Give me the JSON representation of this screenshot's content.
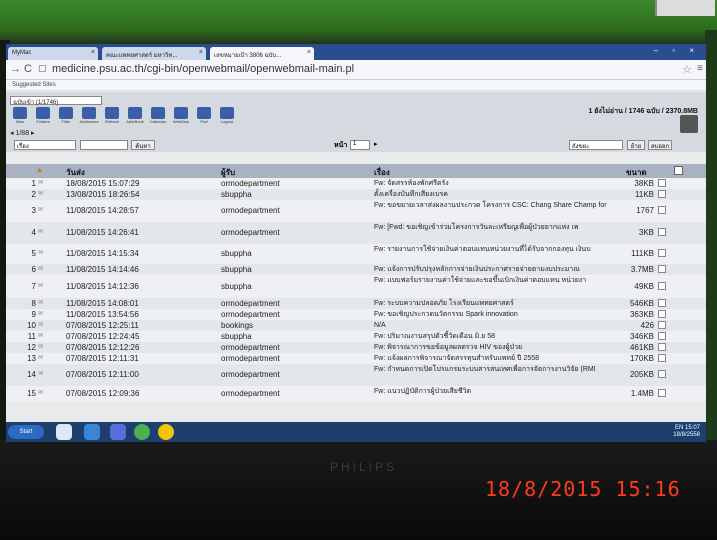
{
  "browser": {
    "tabs": [
      {
        "label": "MyMac"
      },
      {
        "label": "คณะแพทยศาสตร์ มหาวิท..."
      },
      {
        "label": "เลขหมายเป้า 3806 ฉบับ..."
      }
    ],
    "url": "medicine.psu.ac.th/cgi-bin/openwebmail/openwebmail-main.pl",
    "bookmarks_label": "Suggested Sites"
  },
  "webmail": {
    "folder": "ฉบับเข้า (1/1746)",
    "toolbar": [
      {
        "label": "New",
        "icon": "compose-icon"
      },
      {
        "label": "Folders",
        "icon": "folders-icon"
      },
      {
        "label": "Filter",
        "icon": "filter-icon"
      },
      {
        "label": "Addresses",
        "icon": "addressbook-icon"
      },
      {
        "label": "Refresh",
        "icon": "refresh-icon"
      },
      {
        "label": "AddrBook",
        "icon": "contacts-icon"
      },
      {
        "label": "Calendar",
        "icon": "calendar-icon"
      },
      {
        "label": "WebDisk",
        "icon": "webdisk-icon"
      },
      {
        "label": "Pref",
        "icon": "preferences-icon"
      },
      {
        "label": "Logout",
        "icon": "logout-icon"
      }
    ],
    "message_count": "1 ยังไม่อ่าน / 1746 ฉบับ / 2370.8MB",
    "trash_label": "ถังขยะ",
    "page_nav": "◂ 1/88 ▸",
    "search": {
      "field": "เรื่อง",
      "button": "ค้นหา"
    },
    "page": {
      "label": "หน้า",
      "value": "1"
    },
    "move": {
      "target": "ถังขยะ",
      "move_button": "ย้าย",
      "delete_button": "ลบออก"
    },
    "columns": {
      "date": "วันส่ง",
      "from": "ผู้รับ",
      "subject": "เรื่อง",
      "size": "ขนาด"
    },
    "messages": [
      {
        "num": "1",
        "date": "18/08/2015 15:07:29",
        "from": "ormodepartment",
        "subject": "Fw: จัดสรรห้องพักศรีตรัง",
        "size": "38KB"
      },
      {
        "num": "2",
        "date": "13/08/2015 18:26:54",
        "from": "sbuppha",
        "subject": "ตั้งเครื่องบันทึกเสียงเบรค",
        "size": "11KB"
      },
      {
        "num": "3",
        "date": "11/08/2015 14:28:57",
        "from": "ormodepartment",
        "subject": "Fw: ขอขยายเวลาส่งผลงานประกวด โครงการ CSC: Chang Share Champ for",
        "size": "1767"
      },
      {
        "num": "4",
        "date": "11/08/2015 14:26:41",
        "from": "ormodepartment",
        "subject": "Fw: [Fwd: ขอเชิญเข้าร่วมโครงการวันละเหรียญเพื่อผู้ป่วยยากแห่ง เพ",
        "size": "3KB"
      },
      {
        "num": "5",
        "date": "11/08/2015 14:15:34",
        "from": "sbuppha",
        "subject": "Fw: รายงานการใช้จ่ายเงินค่าตอบแทนหน่วยงานที่ได้รับจากกองทุน เงินบ",
        "size": "111KB"
      },
      {
        "num": "6",
        "date": "11/08/2015 14:14:46",
        "from": "sbuppha",
        "subject": "Fw: แจ้งการปรับปรุงหลักการจ่ายเงินประกาศรายจ่ายตามงบประมาณ",
        "size": "3.7MB"
      },
      {
        "num": "7",
        "date": "11/08/2015 14:12:36",
        "from": "sbuppha",
        "subject": "Fw: แบบฟอร์มรายงานค่าใช้จ่ายและขอขึ้นเบิกเงินค่าตอบแทน หน่วยงา",
        "size": "49KB"
      },
      {
        "num": "8",
        "date": "11/08/2015 14:08:01",
        "from": "ormodepartment",
        "subject": "Fw: ระบบความปลอดภัย โรงเรียนแพทยศาสตร์",
        "size": "546KB"
      },
      {
        "num": "9",
        "date": "11/08/2015 13:54:56",
        "from": "ormodepartment",
        "subject": "Fw: ขอเชิญประกวดนวัตกรรม Spark innovation",
        "size": "363KB"
      },
      {
        "num": "10",
        "date": "07/08/2015 12:25:11",
        "from": "bookings",
        "subject": "N/A",
        "size": "426"
      },
      {
        "num": "11",
        "date": "07/08/2015 12:24:45",
        "from": "sbuppha",
        "subject": "Fw: ปริมาณงานสรุปตัวชี้วัดเดือน มิ.ย 58",
        "size": "346KB"
      },
      {
        "num": "12",
        "date": "07/08/2015 12:12:26",
        "from": "ormodepartment",
        "subject": "Fw: พิจารณาการขอข้อมูลผลตรวจ HIV ของผู้ป่วย",
        "size": "461KB"
      },
      {
        "num": "13",
        "date": "07/08/2015 12:11:31",
        "from": "ormodepartment",
        "subject": "Fw: แจ้งผลการพิจารณาจัดสรรทุนสำหรับแพทย์ ปี 2558",
        "size": "170KB"
      },
      {
        "num": "14",
        "date": "07/08/2015 12:11:00",
        "from": "ormodepartment",
        "subject": "Fw: กำหนดการเปิดโปรแกรมระบบสารสนเทศเพื่อการจัดการงานวิจัย (RMI",
        "size": "205KB"
      },
      {
        "num": "15",
        "date": "07/08/2015 12:09:36",
        "from": "ormodepartment",
        "subject": "Fw: แนวปฏิบัติการผู้ป่วยเสียชีวิต",
        "size": "1.4MB"
      }
    ]
  },
  "taskbar": {
    "start": "Start",
    "time": "15:07",
    "date": "18/8/2558",
    "lang": "EN"
  },
  "photo": {
    "timestamp": "18/8/2015   15:16",
    "brand": "PHILIPS"
  }
}
